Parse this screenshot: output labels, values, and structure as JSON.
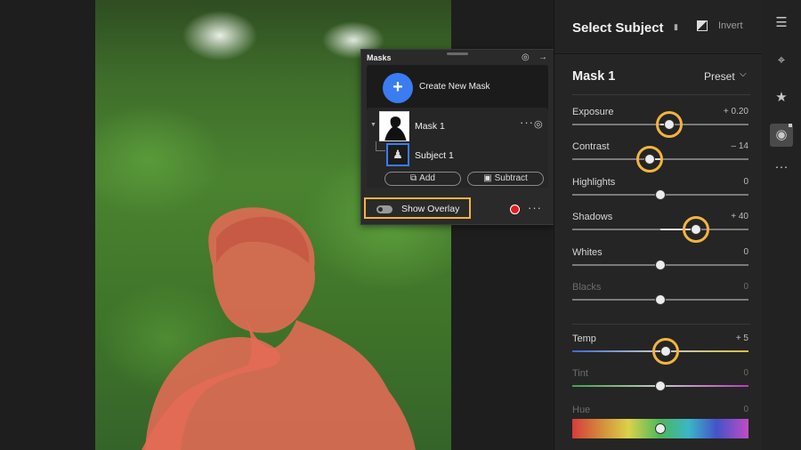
{
  "masks_panel": {
    "title": "Masks",
    "create_mask_label": "Create New Mask",
    "mask_name": "Mask 1",
    "subject_name": "Subject 1",
    "add_label": "Add",
    "subtract_label": "Subtract",
    "show_overlay_label": "Show Overlay",
    "overlay_color": "#e21d1d",
    "icons": [
      "eye-icon",
      "arrow-right-icon",
      "plus-icon",
      "more-icon",
      "person-icon",
      "link-icon"
    ]
  },
  "edit_panel": {
    "title": "Select Subject",
    "invert_label": "Invert",
    "mask_header": "Mask 1",
    "preset_label": "Preset",
    "sliders": [
      {
        "label": "Exposure",
        "value": "+ 0.20",
        "pos": 0.55,
        "highlight": true
      },
      {
        "label": "Contrast",
        "value": "– 14",
        "pos": 0.44,
        "highlight": true
      },
      {
        "label": "Highlights",
        "value": "0",
        "pos": 0.5
      },
      {
        "label": "Shadows",
        "value": "+ 40",
        "pos": 0.7,
        "highlight": true
      },
      {
        "label": "Whites",
        "value": "0",
        "pos": 0.5
      },
      {
        "label": "Blacks",
        "value": "0",
        "pos": 0.5,
        "dim": true
      },
      {
        "label": "Temp",
        "value": "+ 5",
        "pos": 0.53,
        "highlight": true
      },
      {
        "label": "Tint",
        "value": "0",
        "pos": 0.5,
        "dim": true
      },
      {
        "label": "Hue",
        "value": "0",
        "pos": 0.5,
        "dim": true
      }
    ]
  },
  "toolstrip": {
    "tools": [
      "sliders-icon",
      "crop-icon",
      "heal-icon",
      "masking-icon",
      "more-icon"
    ]
  },
  "accent_color": "#f3b43f",
  "selection_color": "#3b7cf0"
}
